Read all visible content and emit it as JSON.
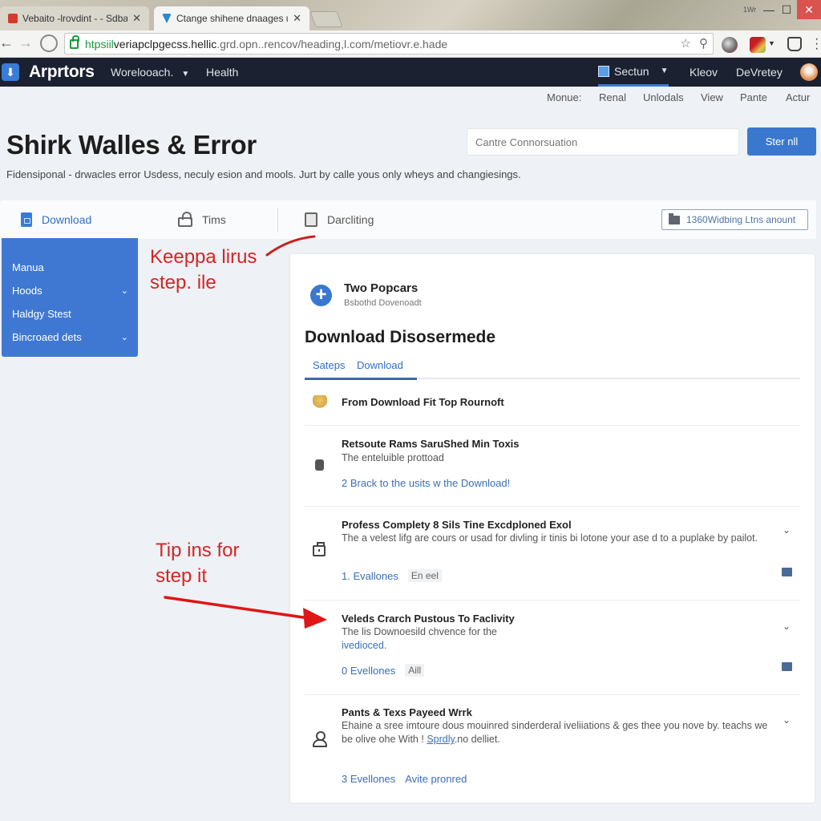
{
  "browser": {
    "tabs": [
      {
        "label": "Vebaito -lrovdint - - Sdbaada",
        "active": false
      },
      {
        "label": "Ctange shihene dnaages u..",
        "active": true
      }
    ],
    "url": {
      "secure": "htpsiil",
      "host": "veriapclpgecss.hellic",
      "path": ".grd.opn..rencov/heading,l.com/metiovr.e.hade"
    },
    "window_user": "1Wr"
  },
  "app": {
    "brand": "Arprtors",
    "nav": [
      {
        "label": "Worelooach.",
        "has_dropdown": true
      },
      {
        "label": "Health",
        "has_dropdown": false
      }
    ],
    "right_nav": {
      "section": "Sectun",
      "items": [
        "Kleov",
        "DeVretey"
      ]
    }
  },
  "subnav": [
    "Monue:",
    "Renal",
    "Unlodals",
    "View",
    "Pante",
    "Actur"
  ],
  "page": {
    "title": "Shirk Walles & Error",
    "description": "Fidensiponal - drwacles error Usdess, neculy esion and mools. Jurt by calle yous only wheys and changiesings.",
    "search_placeholder": "Cantre Connorsuation",
    "start_button": "Ster nll"
  },
  "tabs": [
    {
      "label": "Download",
      "icon": "document-icon",
      "active": true
    },
    {
      "label": "Tims",
      "icon": "unlock-icon",
      "active": false
    },
    {
      "label": "Darcliting",
      "icon": "frame-icon",
      "active": false
    }
  ],
  "badge_button": "1360Widbing Ltns anount",
  "sidebar": {
    "items": [
      {
        "label": "Manua",
        "expandable": false
      },
      {
        "label": "Hoods",
        "expandable": true
      },
      {
        "label": "Haldgy Stest",
        "expandable": false
      },
      {
        "label": "Bincroaed dets",
        "expandable": true
      }
    ]
  },
  "annotations": [
    {
      "text_line1": "Keeppa lirus",
      "text_line2": "step. ile"
    },
    {
      "text_line1": "Tip ins for",
      "text_line2": "step it"
    }
  ],
  "card": {
    "header_title": "Two Popcars",
    "header_sub": "Bsbothd Dovenoadt",
    "title": "Download Disosermede",
    "subtabs": [
      "Sateps",
      "Download"
    ],
    "rows": [
      {
        "icon": "bell-icon",
        "title": "From Download Fit Top Rournoft"
      },
      {
        "icon": "bag-icon",
        "title": "Retsoute Rams SaruShed Min Toxis",
        "desc": "The enteluible prottoad",
        "link": "2 Brack to the usits w the Download!"
      },
      {
        "icon": "lockbox-icon",
        "title": "Profess Complety 8 Sils Tine Excdploned Exol",
        "desc": "The a velest lifg are cours or usad for divling ir tinis bi lotone your ase d to a puplake by pailot.",
        "meta_link": "1. Evallones",
        "meta_tag": "En eel"
      },
      {
        "icon": "arrow-target",
        "title": "Veleds Crarch Pustous To Faclivity",
        "desc": "The lis Downoesild chvence for the",
        "desc_link": "ivedioced.",
        "meta_link": "0 Evellones",
        "meta_tag": "Aill"
      },
      {
        "icon": "user-icon",
        "title": "Pants & Texs Payeed Wrrk",
        "desc_a": "Ehaine a sree imtoure dous mouinred sinderderal iveliiations & ges thee you nove by. teachs we be olive ohe With ! ",
        "desc_link": "Sprdly",
        "desc_b": ".no delliet.",
        "meta_link": "3 Evellones",
        "meta_link2": "Avite pronred"
      }
    ]
  },
  "colors": {
    "accent": "#3a78d0",
    "appbar": "#1b2130",
    "annotation": "#d42525",
    "link": "#3a6fb5"
  }
}
